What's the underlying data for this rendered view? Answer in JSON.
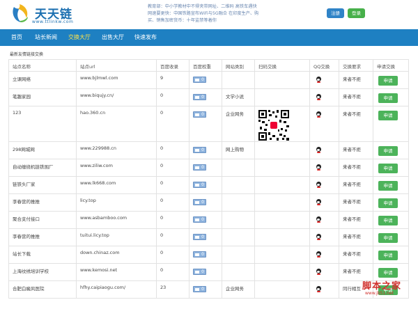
{
  "header": {
    "logo_title": "天天链",
    "logo_url": "www.ttlinkw.com",
    "notice_lines": [
      "教育部：中小学教材中不得夹带网址、二维码 高铁车遇快",
      "网速要更快：中国铁路宣布WiFi与5G融合 在印度生产、购",
      "买、销售加密货币：十年监禁等着你"
    ],
    "register_label": "注册",
    "login_label": "登录"
  },
  "nav": {
    "items": [
      {
        "label": "首页",
        "active": false
      },
      {
        "label": "站长新闻",
        "active": false
      },
      {
        "label": "交换大厅",
        "active": true
      },
      {
        "label": "出售大厅",
        "active": false
      },
      {
        "label": "快速发布",
        "active": false
      }
    ]
  },
  "section_title": "最新友情链接交换",
  "table": {
    "columns": [
      "站点名称",
      "站点url",
      "百度收录",
      "百度权重",
      "网站类别",
      "扫码交换",
      "QQ交换",
      "交换要求",
      "申请交换"
    ],
    "apply_label": "申请",
    "rows": [
      {
        "name": "立课网络",
        "url": "www.bjlmwl.com",
        "index": "9",
        "weight": "0",
        "category": "",
        "qr": false,
        "qq": true,
        "req": "来者不拒"
      },
      {
        "name": "笔趣家园",
        "url": "www.biqujy.cn/",
        "index": "0",
        "weight": "0",
        "category": "文学小说",
        "qr": false,
        "qq": true,
        "req": "来者不拒"
      },
      {
        "name": "123",
        "url": "hao.360.cn",
        "index": "0",
        "weight": "0",
        "category": "企业网务",
        "qr": true,
        "qq": true,
        "req": "来者不拒"
      },
      {
        "name": "298网城网",
        "url": "www.229988.cn",
        "index": "0",
        "weight": "0",
        "category": "网上购物",
        "qr": false,
        "qq": true,
        "req": "来者不拒"
      },
      {
        "name": "自动缠绕机链铁围厂",
        "url": "www.ziliw.com",
        "index": "0",
        "weight": "0",
        "category": "",
        "qr": false,
        "qq": true,
        "req": "来者不拒"
      },
      {
        "name": "链铁头厂家",
        "url": "www.lk668.com",
        "index": "0",
        "weight": "0",
        "category": "",
        "qr": false,
        "qq": true,
        "req": "来者不拒"
      },
      {
        "name": "李春营的推推",
        "url": "licy.top",
        "index": "0",
        "weight": "0",
        "category": "",
        "qr": false,
        "qq": true,
        "req": "来者不拒"
      },
      {
        "name": "聚合支付接口",
        "url": "www.asbamboo.com",
        "index": "0",
        "weight": "0",
        "category": "",
        "qr": false,
        "qq": true,
        "req": "来者不拒"
      },
      {
        "name": "李春营的推推",
        "url": "tuitui.licy.top",
        "index": "0",
        "weight": "0",
        "category": "",
        "qr": false,
        "qq": true,
        "req": "来者不拒"
      },
      {
        "name": "站长下载",
        "url": "down.chinaz.com",
        "index": "0",
        "weight": "0",
        "category": "",
        "qr": false,
        "qq": true,
        "req": "来者不拒"
      },
      {
        "name": "上海纹绣培训学校",
        "url": "www.kemosi.net",
        "index": "0",
        "weight": "0",
        "category": "",
        "qr": false,
        "qq": true,
        "req": "来者不拒"
      },
      {
        "name": "合肥白癜风医院",
        "url": "hfhy.caipiaogu.com/",
        "index": "23",
        "weight": "0",
        "category": "企业网务",
        "qr": false,
        "qq": true,
        "req": "同行相互"
      }
    ]
  },
  "watermark": {
    "text": "脚本之家",
    "url": "www.jb51.net"
  }
}
